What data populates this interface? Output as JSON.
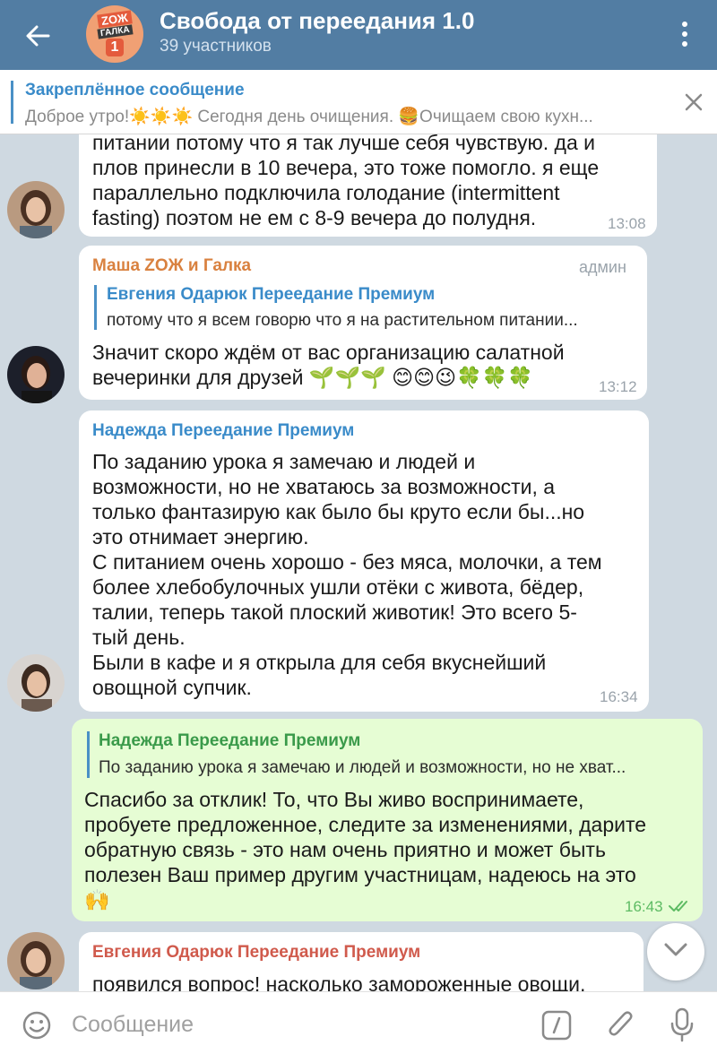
{
  "header": {
    "title": "Свобода от переедания 1.0",
    "subtitle": "39 участников",
    "logo": {
      "line1": "ZОЖ",
      "line2": "ГАЛКА",
      "line3": "1"
    }
  },
  "pinned": {
    "title": "Закреплённое сообщение",
    "text": "Доброе утро!☀️☀️☀️  Сегодня день очищения. 🍔Очищаем свою кухн..."
  },
  "messages": [
    {
      "text_lines": [
        "питании потому что я так лучше себя чувствую. да и",
        "плов принесли в 10 вечера, это тоже помогло. я еще",
        "параллельно подключила голодание (intermittent",
        "fasting) поэтом не ем с 8-9 вечера до полудня."
      ],
      "time": "13:08"
    },
    {
      "sender": "Маша ZОЖ и Галка",
      "badge": "админ",
      "reply_name": "Евгения Одарюк Переедание Премиум",
      "reply_text": "потому что я всем говорю что я на растительном питании...",
      "text_lines": [
        "Значит скоро ждём от вас организацию  салатной",
        "вечеринки для друзей 🌱🌱🌱 😊😊😉🍀🍀🍀"
      ],
      "time": "13:12"
    },
    {
      "sender": "Надежда Переедание Премиум",
      "text_lines": [
        "По заданию урока я замечаю и людей и",
        "возможности, но не хватаюсь за возможности, а",
        "только фантазирую как было бы круто если бы...но",
        "это отнимает энергию.",
        "С питанием очень хорошо - без мяса, молочки, а тем",
        "более хлебобулочных ушли отёки с живота, бёдер,",
        "талии, теперь такой плоский животик! Это всего 5-",
        "тый день.",
        "Были в кафе и я открыла для себя вкуснейший",
        "овощной супчик."
      ],
      "time": "16:34"
    },
    {
      "reply_name": "Надежда Переедание Премиум",
      "reply_text": "По заданию урока я замечаю и людей и возможности, но не хват...",
      "text_lines": [
        "Спасибо за отклик! То, что Вы живо воспринимаете,",
        "пробуете предложенное, следите за изменениями, дарите",
        "обратную связь - это нам очень приятно и может быть",
        "полезен Ваш пример другим участницам, надеюсь на это",
        "🙌"
      ],
      "time": "16:43"
    },
    {
      "sender": "Евгения Одарюк Переедание Премиум",
      "text_lines": [
        "появился вопрос! насколько замороженные овощи,"
      ]
    }
  ],
  "input": {
    "placeholder": "Сообщение"
  },
  "colors": {
    "header": "#527da3",
    "accent": "#3a8bc9",
    "sender_masha": "#d9813f",
    "sender_nadezhda": "#3a8bc9",
    "sender_evgenia": "#d05a4c",
    "outgoing_bubble": "#e6fdd4",
    "read_check": "#5dbb63"
  },
  "icons": [
    "back-arrow-icon",
    "more-vert-icon",
    "close-icon",
    "emoji-icon",
    "bot-command-icon",
    "attach-icon",
    "mic-icon",
    "chevron-down-icon",
    "double-check-icon"
  ]
}
